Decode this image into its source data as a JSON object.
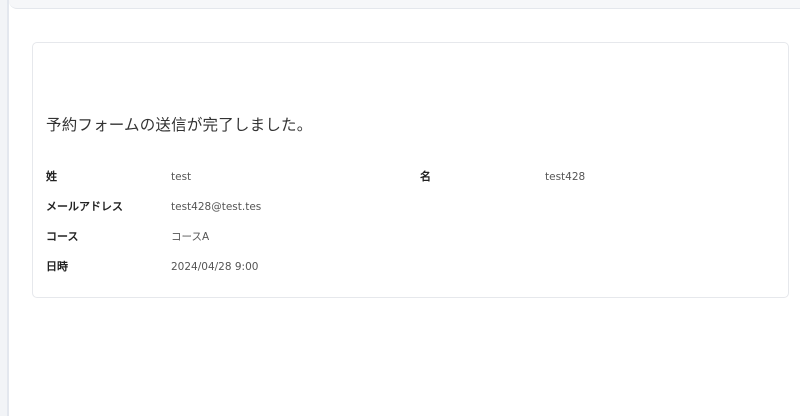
{
  "confirmation": {
    "title": "予約フォームの送信が完了しました。",
    "fields": {
      "last_name": {
        "label": "姓",
        "value": "test"
      },
      "first_name": {
        "label": "名",
        "value": "test428"
      },
      "email": {
        "label": "メールアドレス",
        "value": "test428@test.tes"
      },
      "course": {
        "label": "コース",
        "value": "コースA"
      },
      "datetime": {
        "label": "日時",
        "value": "2024/04/28 9:00"
      }
    }
  }
}
